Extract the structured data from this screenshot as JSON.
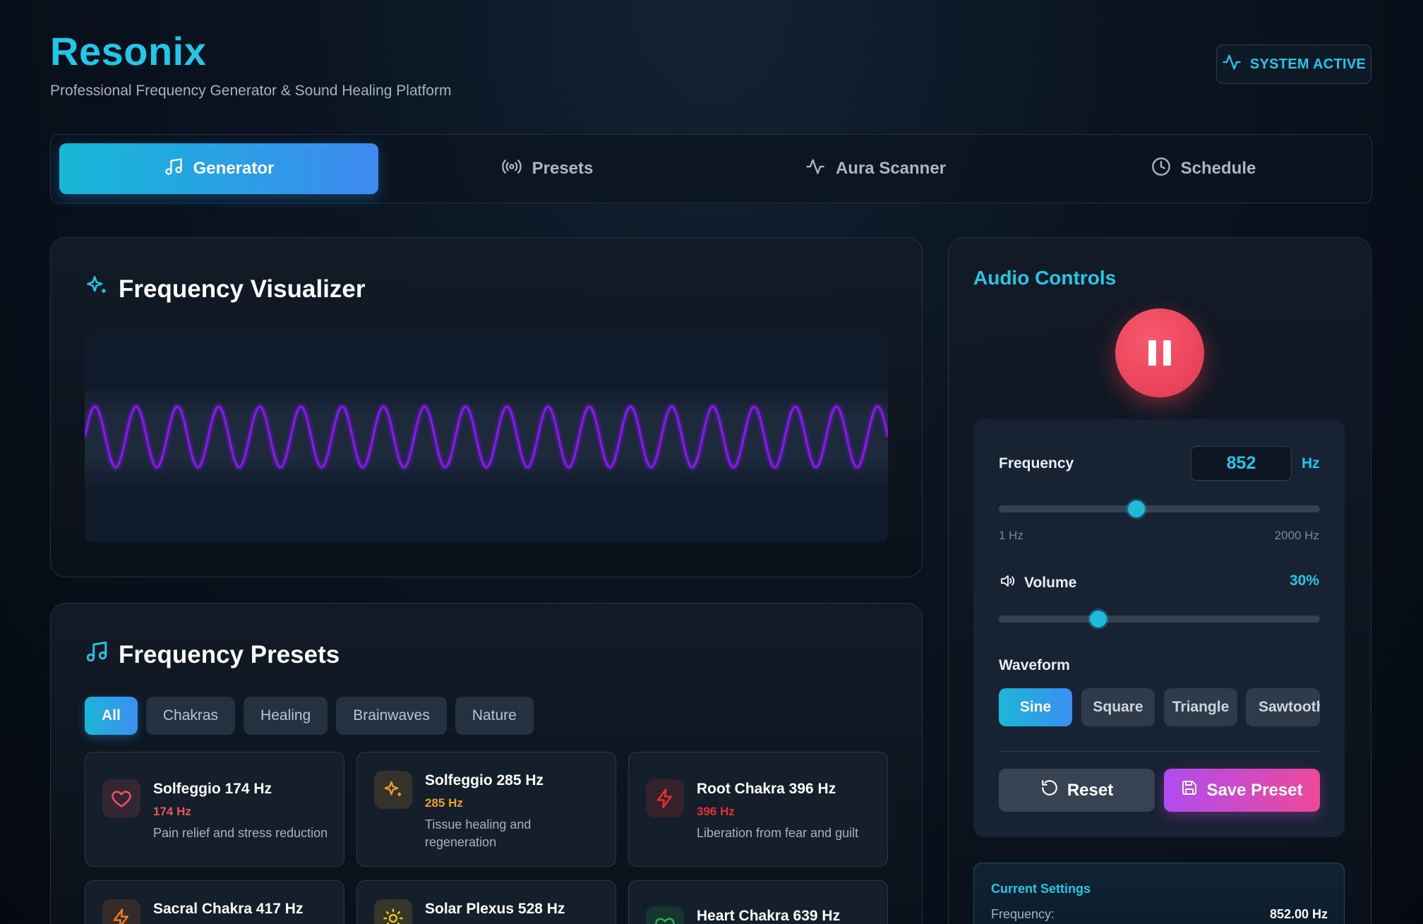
{
  "app": {
    "title": "Resonix",
    "subtitle": "Professional Frequency Generator & Sound Healing Platform",
    "status_badge": "SYSTEM ACTIVE"
  },
  "tabs": [
    {
      "label": "Generator",
      "icon": "music-note-icon",
      "active": true
    },
    {
      "label": "Presets",
      "icon": "radio-broadcast-icon",
      "active": false
    },
    {
      "label": "Aura Scanner",
      "icon": "activity-pulse-icon",
      "active": false
    },
    {
      "label": "Schedule",
      "icon": "clock-icon",
      "active": false
    }
  ],
  "visualizer": {
    "title": "Frequency Visualizer",
    "icon": "sparkles-icon",
    "wave_color": "#7b1fd9"
  },
  "presets": {
    "title": "Frequency Presets",
    "icon": "music-note-icon",
    "filters": [
      "All",
      "Chakras",
      "Healing",
      "Brainwaves",
      "Nature"
    ],
    "active_filter": "All",
    "items": [
      {
        "name": "Solfeggio 174 Hz",
        "hz": "174 Hz",
        "desc": "Pain relief and stress reduction",
        "icon": "heart-icon",
        "color": "#f0525e"
      },
      {
        "name": "Solfeggio 285 Hz",
        "hz": "285 Hz",
        "desc": "Tissue healing and regeneration",
        "icon": "sparkles-icon",
        "color": "#f0a02a"
      },
      {
        "name": "Root Chakra 396 Hz",
        "hz": "396 Hz",
        "desc": "Liberation from fear and guilt",
        "icon": "lightning-icon",
        "color": "#e8302f"
      },
      {
        "name": "Sacral Chakra 417 Hz",
        "hz": "",
        "desc": "",
        "icon": "lightning-icon",
        "color": "#f07a22"
      },
      {
        "name": "Solar Plexus 528 Hz",
        "hz": "",
        "desc": "",
        "icon": "sun-icon",
        "color": "#f0c21e"
      },
      {
        "name": "Heart Chakra 639 Hz",
        "hz": "",
        "desc": "",
        "icon": "heart-icon",
        "color": "#28b550"
      }
    ]
  },
  "controls": {
    "title": "Audio Controls",
    "play_state": "playing",
    "frequency_label": "Frequency",
    "frequency_value": "852",
    "frequency_unit": "Hz",
    "frequency_min_label": "1 Hz",
    "frequency_max_label": "2000 Hz",
    "frequency_min": 1,
    "frequency_max": 2000,
    "frequency": 852,
    "volume_label": "Volume",
    "volume_display": "30%",
    "volume": 30,
    "waveform_label": "Waveform",
    "waveforms": [
      "Sine",
      "Square",
      "Triangle",
      "Sawtooth"
    ],
    "active_waveform": "Sine",
    "reset_label": "Reset",
    "save_label": "Save Preset"
  },
  "current_settings": {
    "title": "Current Settings",
    "frequency_label": "Frequency:",
    "frequency_value": "852.00 Hz"
  },
  "colors": {
    "accent": "#22c7e8",
    "accent_blue": "#3d8af0",
    "pause_button": "#e8405a",
    "save_gradient_start": "#b04cf0",
    "save_gradient_end": "#ec4899"
  }
}
